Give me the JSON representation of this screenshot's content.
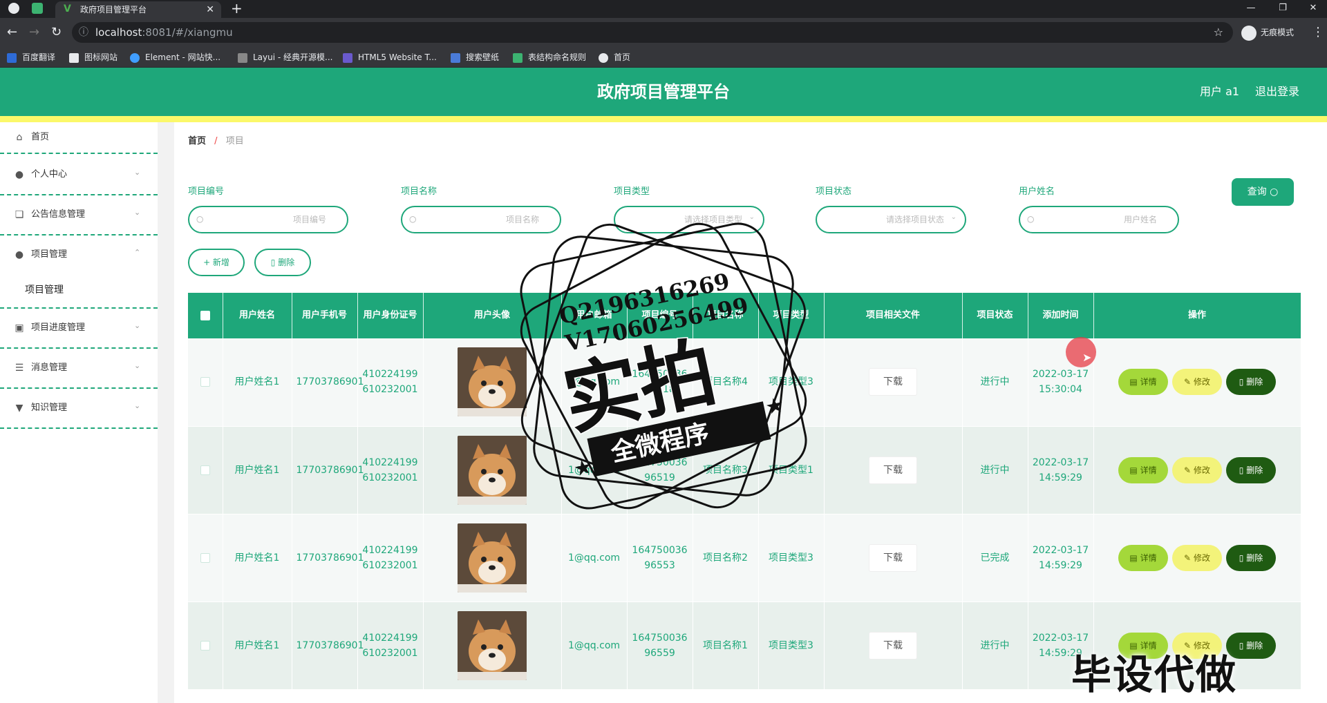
{
  "browser": {
    "tab_title": "政府项目管理平台",
    "tab_favicon_letter": "V",
    "url_host": "localhost",
    "url_rest": ":8081/#/xiangmu",
    "incognito_label": "无痕模式",
    "bookmarks": [
      "百度翻译",
      "图标网站",
      "Element - 网站快...",
      "Layui - 经典开源模...",
      "HTML5 Website T...",
      "搜索壁纸",
      "表结构命名规则",
      "首页"
    ]
  },
  "header": {
    "title": "政府项目管理平台",
    "user_label": "用户 a1",
    "logout_label": "退出登录",
    "accent": "#1ea77a",
    "stripe": "#fbf86a"
  },
  "sidebar": {
    "items": [
      {
        "label": "首页",
        "icon": "home-icon"
      },
      {
        "label": "个人中心",
        "icon": "user-icon"
      },
      {
        "label": "公告信息管理",
        "icon": "copy-icon"
      },
      {
        "label": "项目管理",
        "icon": "user-icon"
      },
      {
        "label": "项目进度管理",
        "icon": "briefcase-icon"
      },
      {
        "label": "消息管理",
        "icon": "list-icon"
      },
      {
        "label": "知识管理",
        "icon": "pin-icon"
      }
    ],
    "sub_item": "项目管理"
  },
  "breadcrumb": {
    "home": "首页",
    "separator": "/",
    "current": "项目"
  },
  "filters": [
    {
      "label": "项目编号",
      "placeholder": "项目编号"
    },
    {
      "label": "项目名称",
      "placeholder": "项目名称"
    },
    {
      "label": "项目类型",
      "placeholder": "请选择项目类型"
    },
    {
      "label": "项目状态",
      "placeholder": "请选择项目状态"
    },
    {
      "label": "用户姓名",
      "placeholder": "用户姓名"
    }
  ],
  "actions": {
    "query": "查询",
    "add": "+ 新增",
    "delete": "删除"
  },
  "table": {
    "columns": [
      "用户姓名",
      "用户手机号",
      "用户身份证号",
      "用户头像",
      "用户邮箱",
      "项目编号",
      "项目名称",
      "项目类型",
      "项目相关文件",
      "项目状态",
      "添加时间",
      "操作"
    ],
    "rows": [
      {
        "name": "用户姓名1",
        "phone": "17703786901",
        "idcard": "410224199610232001",
        "email": "1@qq.com",
        "code": "16475003691818",
        "pname": "项目名称4",
        "ptype": "项目类型3",
        "file": "下载",
        "status": "进行中",
        "time": "2022-03-17 15:30:04"
      },
      {
        "name": "用户姓名1",
        "phone": "17703786901",
        "idcard": "410224199610232001",
        "email": "1@qq.com",
        "code": "16475003696519",
        "pname": "项目名称3",
        "ptype": "项目类型1",
        "file": "下载",
        "status": "进行中",
        "time": "2022-03-17 14:59:29"
      },
      {
        "name": "用户姓名1",
        "phone": "17703786901",
        "idcard": "410224199610232001",
        "email": "1@qq.com",
        "code": "16475003696553",
        "pname": "项目名称2",
        "ptype": "项目类型3",
        "file": "下载",
        "status": "已完成",
        "time": "2022-03-17 14:59:29"
      },
      {
        "name": "用户姓名1",
        "phone": "17703786901",
        "idcard": "410224199610232001",
        "email": "1@qq.com",
        "code": "16475003696559",
        "pname": "项目名称1",
        "ptype": "项目类型3",
        "file": "下载",
        "status": "进行中",
        "time": "2022-03-17 14:59:29"
      }
    ],
    "op_labels": {
      "detail": "详情",
      "edit": "修改",
      "delete": "删除"
    }
  },
  "watermark": {
    "stamp_line1": "Q2196316269",
    "stamp_line2": "V17060256499",
    "stamp_main": "实拍",
    "stamp_banner": "全微程序",
    "bottom_text": "毕设代做"
  }
}
